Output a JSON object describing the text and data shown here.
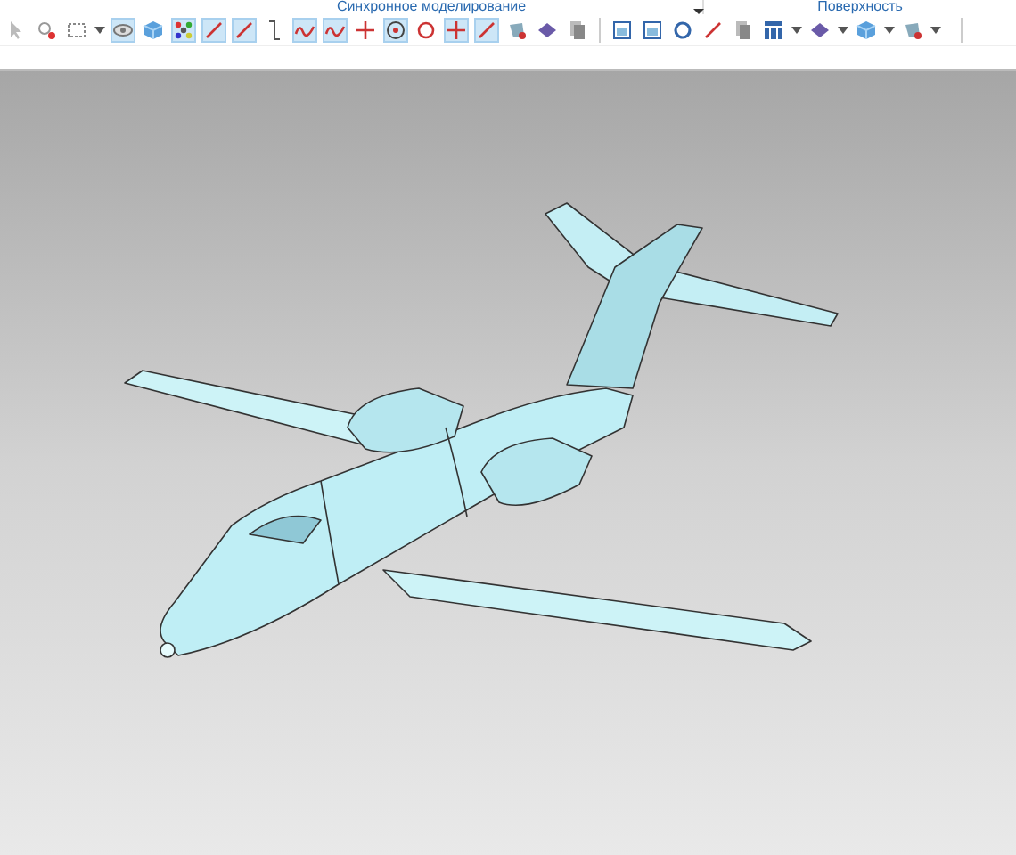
{
  "ribbon_groups": [
    {
      "label": "Синхронное моделирование",
      "has_menu": true
    },
    {
      "label": "Поверхность",
      "has_menu": false
    }
  ],
  "toolbar": [
    {
      "kind": "pointer",
      "on": false
    },
    {
      "kind": "filter",
      "on": false
    },
    {
      "kind": "select-box",
      "on": false
    },
    {
      "kind": "caret"
    },
    {
      "kind": "eye",
      "on": true
    },
    {
      "kind": "cube",
      "on": false
    },
    {
      "kind": "points",
      "on": true
    },
    {
      "kind": "line",
      "on": true
    },
    {
      "kind": "line",
      "on": true
    },
    {
      "kind": "hook",
      "on": false
    },
    {
      "kind": "wave",
      "on": true
    },
    {
      "kind": "wave",
      "on": true
    },
    {
      "kind": "cross",
      "on": false
    },
    {
      "kind": "target",
      "on": true
    },
    {
      "kind": "circle",
      "on": false
    },
    {
      "kind": "cross",
      "on": true
    },
    {
      "kind": "line",
      "on": true
    },
    {
      "kind": "shape",
      "on": false
    },
    {
      "kind": "diamond",
      "on": false
    },
    {
      "kind": "pages",
      "on": false
    },
    {
      "kind": "sep"
    },
    {
      "kind": "frame",
      "on": false
    },
    {
      "kind": "frame",
      "on": false
    },
    {
      "kind": "ring",
      "on": false
    },
    {
      "kind": "line",
      "on": false
    },
    {
      "kind": "pages",
      "on": false
    },
    {
      "kind": "grid",
      "on": false
    },
    {
      "kind": "caret"
    },
    {
      "kind": "diamond",
      "on": false
    },
    {
      "kind": "caret"
    },
    {
      "kind": "cube",
      "on": false
    },
    {
      "kind": "caret"
    },
    {
      "kind": "shape",
      "on": false
    },
    {
      "kind": "caret"
    }
  ]
}
